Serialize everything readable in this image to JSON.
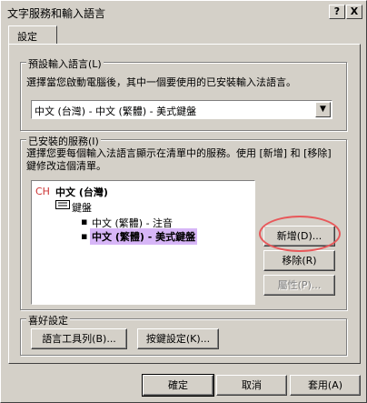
{
  "window": {
    "title": "文字服務和輸入語言",
    "help_button": "?",
    "close_button": "X"
  },
  "tab": {
    "label": "設定"
  },
  "default_language": {
    "legend": "預設輸入語言(L)",
    "description": "選擇當您啟動電腦後，其中一個要使用的已安裝輸入法語言。",
    "selected_value": "中文 (台灣) - 中文 (繁體) - 美式鍵盤"
  },
  "installed_services": {
    "legend": "已安裝的服務(I)",
    "description": "選擇您要每個輸入法語言顯示在清單中的服務。使用 [新增] 和 [移除] 鍵修改這個清單。",
    "language_code": "CH",
    "language_name": "中文 (台灣)",
    "category": "鍵盤",
    "items": [
      "中文 (繁體) - 注音",
      "中文 (繁體) - 美式鍵盤"
    ],
    "selected_color": "#d7b6f7",
    "add_button": "新增(D)...",
    "remove_button": "移除(R)",
    "properties_button": "屬性(P)..."
  },
  "preferences": {
    "legend": "喜好設定",
    "language_bar_button": "語言工具列(B)...",
    "key_settings_button": "按鍵設定(K)..."
  },
  "footer": {
    "ok_button": "確定",
    "cancel_button": "取消",
    "apply_button": "套用(A)"
  },
  "annotation_color": "#e8585a"
}
